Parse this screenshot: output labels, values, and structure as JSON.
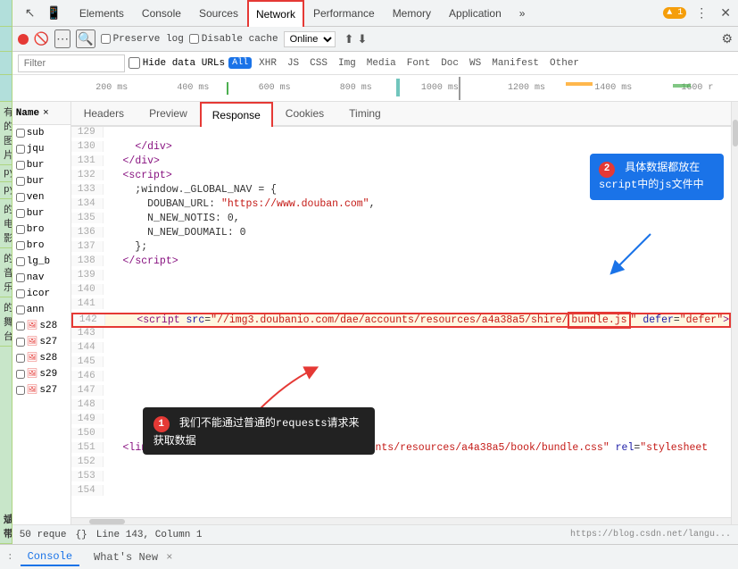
{
  "tabs": {
    "elements": "Elements",
    "console": "Console",
    "sources": "Sources",
    "network": "Network",
    "performance": "Performance",
    "memory": "Memory",
    "application": "Application",
    "more": "»"
  },
  "network_toolbar": {
    "preserve_log": "Preserve log",
    "disable_cache": "Disable cache",
    "online": "Online",
    "settings_label": "⚙"
  },
  "filter_bar": {
    "placeholder": "Filter",
    "hide_data": "Hide data URLs",
    "all": "All",
    "xhr": "XHR",
    "js": "JS",
    "css": "CSS",
    "img": "Img",
    "media": "Media",
    "font": "Font",
    "doc": "Doc",
    "ws": "WS",
    "manifest": "Manifest",
    "other": "Other"
  },
  "timeline": {
    "marks": [
      "200 ms",
      "400 ms",
      "600 ms",
      "800 ms",
      "1000 ms",
      "1200 ms",
      "1400 ms",
      "1600 r"
    ]
  },
  "panel_tabs": {
    "name": "Name",
    "x": "×",
    "headers": "Headers",
    "preview": "Preview",
    "response": "Response",
    "cookies": "Cookies",
    "timing": "Timing"
  },
  "file_list": [
    {
      "name": "sub",
      "icon": "📄"
    },
    {
      "name": "jqu",
      "icon": "📄"
    },
    {
      "name": "bur",
      "icon": "📄"
    },
    {
      "name": "bur",
      "icon": "📄"
    },
    {
      "name": "ven",
      "icon": "📄"
    },
    {
      "name": "bur",
      "icon": "📄"
    },
    {
      "name": "bro",
      "icon": "📄"
    },
    {
      "name": "bro",
      "icon": "📄"
    },
    {
      "name": "lg_b",
      "icon": "📄"
    },
    {
      "name": "nav",
      "icon": "📄"
    },
    {
      "name": "icor",
      "icon": "📄"
    },
    {
      "name": "ann",
      "icon": "📄"
    },
    {
      "name": "s28",
      "icon": "🖼"
    },
    {
      "name": "s27",
      "icon": "🖼"
    },
    {
      "name": "s28",
      "icon": "🖼"
    },
    {
      "name": "s29",
      "icon": "🖼"
    },
    {
      "name": "s27",
      "icon": "🖼"
    }
  ],
  "code_lines": [
    {
      "num": "129",
      "content": ""
    },
    {
      "num": "130",
      "content": "    </div>"
    },
    {
      "num": "131",
      "content": "  </div>"
    },
    {
      "num": "132",
      "content": "  <script>"
    },
    {
      "num": "133",
      "content": "    ;window._GLOBAL_NAV = {"
    },
    {
      "num": "134",
      "content": "      DOUBAN_URL: \"https://www.douban.com\","
    },
    {
      "num": "135",
      "content": "      N_NEW_NOTIS: 0,"
    },
    {
      "num": "136",
      "content": "      N_NEW_DOUMAIL: 0"
    },
    {
      "num": "137",
      "content": "    };"
    },
    {
      "num": "138",
      "content": "  <\\/script>"
    },
    {
      "num": "139",
      "content": ""
    },
    {
      "num": "140",
      "content": ""
    },
    {
      "num": "141",
      "content": ""
    },
    {
      "num": "142",
      "content": "    <script src=\"//img3.doubanio.com/dae/accounts/resources/a4a38a5/shire/bundle.js\" defer=\"defer\">"
    },
    {
      "num": "143",
      "content": ""
    },
    {
      "num": "144",
      "content": ""
    },
    {
      "num": "145",
      "content": ""
    },
    {
      "num": "146",
      "content": ""
    },
    {
      "num": "147",
      "content": ""
    },
    {
      "num": "148",
      "content": ""
    },
    {
      "num": "149",
      "content": ""
    },
    {
      "num": "150",
      "content": ""
    },
    {
      "num": "151",
      "content": "  <link href=\"//img3.doubanio.com/dae/accounts/resources/a4a38a5/book/bundle.css\" rel=\"stylesheet"
    },
    {
      "num": "152",
      "content": ""
    },
    {
      "num": "153",
      "content": ""
    },
    {
      "num": "154",
      "content": ""
    }
  ],
  "status_bar": {
    "requests": "50 reque",
    "bracket": "{}",
    "line_info": "Line 143, Column 1"
  },
  "annotations": {
    "ann1_circle": "1",
    "ann1_text": "我们不能通过普通的requests请求来获取数据",
    "ann2_circle": "2",
    "ann2_text": "具体数据都放在script中的js文件中"
  },
  "console_bar": {
    "console": "Console",
    "whats_new": "What's New",
    "close": "×"
  },
  "left_sidebar": {
    "items": [
      "有的图片",
      "python",
      "python",
      "的电影",
      "的音乐",
      "的舞台",
      "斌 带"
    ]
  },
  "warning": "▲ 1"
}
